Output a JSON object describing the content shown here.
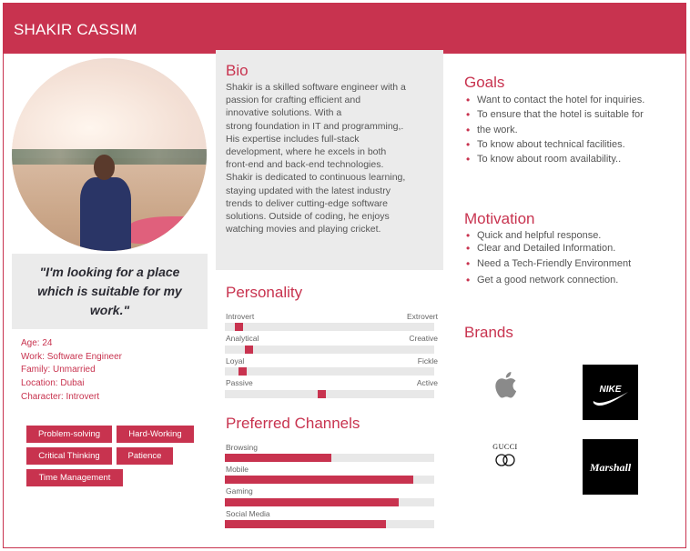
{
  "persona": {
    "name": "SHAKIR CASSIM"
  },
  "quote": "\"I'm looking for a place which is suitable for my work.\"",
  "facts": {
    "age": "Age: 24",
    "work": "Work: Software Engineer",
    "family": "Family: Unmarried",
    "location": "Location: Dubai",
    "character": "Character: Introvert"
  },
  "tags": [
    "Problem-solving",
    "Hard-Working",
    "Critical Thinking",
    "Patience",
    "Time Management"
  ],
  "bio": {
    "title": "Bio",
    "lines": [
      "Shakir is a skilled software engineer with a",
      "passion for crafting efficient and",
      "innovative solutions. With a",
      "strong foundation in IT and programming,.",
      "His expertise includes full-stack",
      "development, where he excels in both",
      "front-end and back-end technologies.",
      "Shakir is dedicated to continuous learning,",
      "staying updated with the latest industry",
      "trends to deliver cutting-edge software",
      "solutions. Outside of coding, he enjoys",
      "watching movies and playing cricket."
    ]
  },
  "personality": {
    "title": "Personality",
    "scales": [
      {
        "left": "Introvert",
        "right": "Extrovert",
        "value": 0.05
      },
      {
        "left": "Analytical",
        "right": "Creative",
        "value": 0.1
      },
      {
        "left": "Loyal",
        "right": "Fickle",
        "value": 0.07
      },
      {
        "left": "Passive",
        "right": "Active",
        "value": 0.46
      }
    ]
  },
  "channels": {
    "title": "Preferred Channels",
    "items": [
      {
        "label": "Browsing",
        "value": 0.51
      },
      {
        "label": "Mobile",
        "value": 0.9
      },
      {
        "label": "Gaming",
        "value": 0.83
      },
      {
        "label": "Social Media",
        "value": 0.77
      }
    ]
  },
  "goals": {
    "title": "Goals",
    "items": [
      "Want to contact the hotel for inquiries.",
      "To ensure that the hotel is suitable for",
      "the work.",
      "To know about technical facilities.",
      "To know about room availability.."
    ]
  },
  "motivation": {
    "title": "Motivation",
    "items": [
      "Quick and helpful response.",
      "Clear and Detailed Information.",
      "Need a Tech-Friendly Environment",
      "Get a good network connection."
    ]
  },
  "brands": {
    "title": "Brands",
    "gucci": "GUCCI",
    "marshall": "Marshall",
    "icons": [
      "apple-logo",
      "nike-logo",
      "gucci-logo",
      "marshall-logo"
    ]
  },
  "colors": {
    "accent": "#c8334f",
    "panel": "#ebebeb"
  }
}
